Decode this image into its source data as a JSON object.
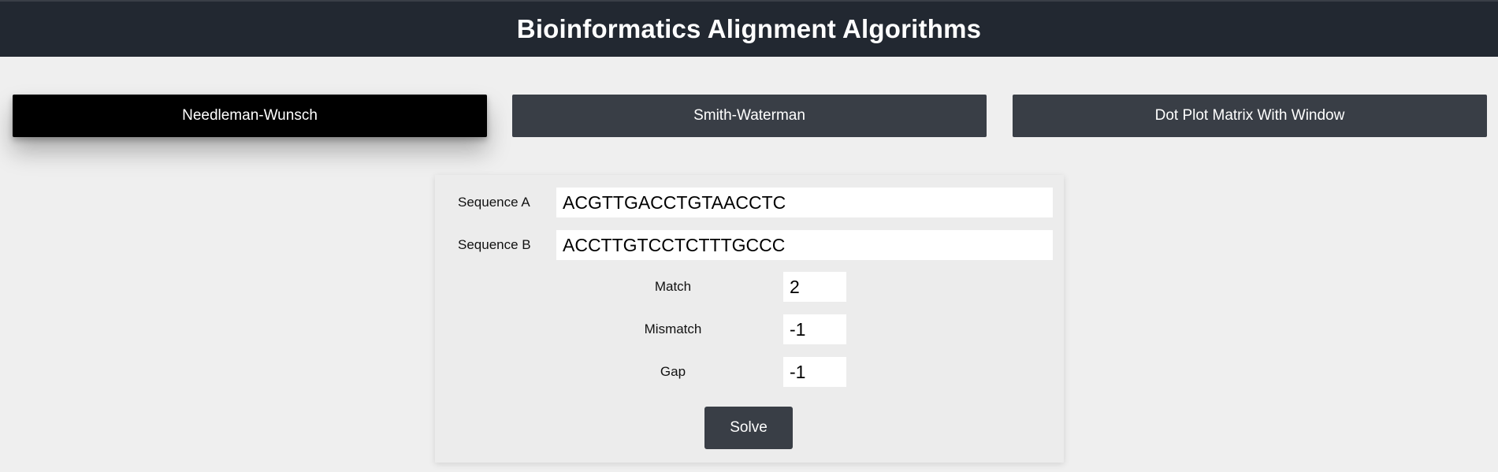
{
  "header": {
    "title": "Bioinformatics Alignment Algorithms"
  },
  "tabs": [
    {
      "label": "Needleman-Wunsch",
      "active": true
    },
    {
      "label": "Smith-Waterman",
      "active": false
    },
    {
      "label": "Dot Plot Matrix With Window",
      "active": false
    }
  ],
  "form": {
    "sequence_a": {
      "label": "Sequence A",
      "value": "ACGTTGACCTGTAACCTC"
    },
    "sequence_b": {
      "label": "Sequence B",
      "value": "ACCTTGTCCTCTTTGCCC"
    },
    "match": {
      "label": "Match",
      "value": "2"
    },
    "mismatch": {
      "label": "Mismatch",
      "value": "-1"
    },
    "gap": {
      "label": "Gap",
      "value": "-1"
    },
    "solve_label": "Solve"
  },
  "colors": {
    "header_bg": "#222831",
    "tab_bg": "#393e46",
    "tab_active_bg": "#000000",
    "page_bg": "#efefef"
  }
}
